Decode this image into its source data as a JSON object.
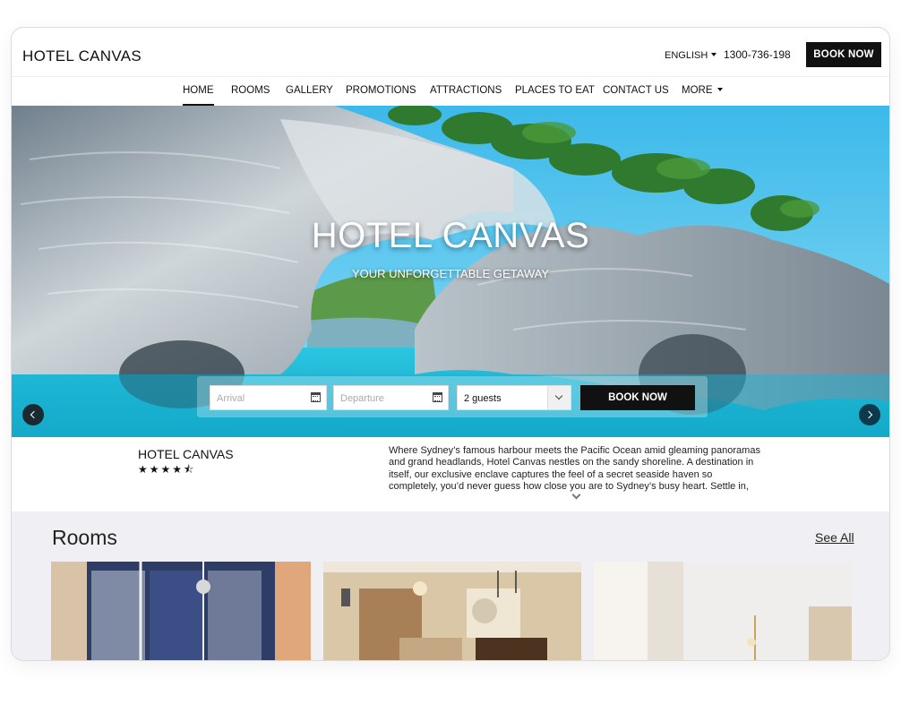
{
  "header": {
    "logo": "HOTEL CANVAS",
    "language": "ENGLISH",
    "phone": "1300-736-198",
    "book_now": "BOOK NOW"
  },
  "nav": {
    "items": [
      {
        "label": "HOME",
        "active": true
      },
      {
        "label": "ROOMS"
      },
      {
        "label": "GALLERY"
      },
      {
        "label": "PROMOTIONS"
      },
      {
        "label": "ATTRACTIONS"
      },
      {
        "label": "PLACES TO EAT"
      },
      {
        "label": "CONTACT US"
      },
      {
        "label": "MORE"
      }
    ]
  },
  "hero": {
    "title": "HOTEL CANVAS",
    "subtitle": "YOUR UNFORGETTABLE GETAWAY",
    "booking": {
      "arrival_placeholder": "Arrival",
      "departure_placeholder": "Departure",
      "guests_value": "2 guests",
      "book_now": "BOOK NOW"
    }
  },
  "info": {
    "name": "HOTEL CANVAS",
    "rating": 4.5,
    "stars": "★★★★⯪",
    "description": "Where Sydney’s famous harbour meets the Pacific Ocean amid gleaming panoramas and grand headlands, Hotel Canvas nestles on the sandy shoreline. A destination in itself, our exclusive enclave captures the feel of a secret seaside haven so completely, you’d never guess how close you are to Sydney’s busy heart. Settle in, slow down and…"
  },
  "rooms": {
    "title": "Rooms",
    "see_all": "See All"
  },
  "colors": {
    "primary": "#111111",
    "sky": "#3fc3ef",
    "sea": "#19b8d8",
    "rooms_bg": "#f0f0f4"
  }
}
